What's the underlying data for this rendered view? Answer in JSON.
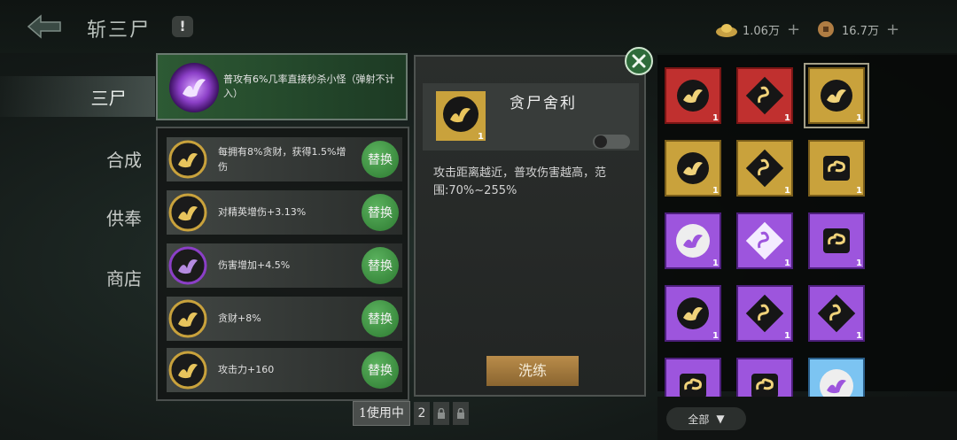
{
  "header": {
    "title": "斩三尸",
    "info": "!"
  },
  "currency": [
    {
      "icon": "gold-ingot-icon",
      "amount": "1.06万"
    },
    {
      "icon": "copper-coin-icon",
      "amount": "16.7万"
    }
  ],
  "tabs": [
    "三尸",
    "合成",
    "供奉",
    "商店"
  ],
  "effect_top": {
    "text": "普攻有6%几率直接秒杀小怪（弹射不计入）"
  },
  "effects": [
    {
      "text": "每拥有8%贪财，获得1.5%增伤",
      "button": "替换",
      "color": "gold"
    },
    {
      "text": "对精英增伤+3.13%",
      "button": "替换",
      "color": "gold"
    },
    {
      "text": "伤害增加+4.5%",
      "button": "替换",
      "color": "purple"
    },
    {
      "text": "贪财+8%",
      "button": "替换",
      "color": "gold"
    },
    {
      "text": "攻击力+160",
      "button": "替换",
      "color": "gold"
    }
  ],
  "pager": {
    "current": "1使用中",
    "next": "2"
  },
  "detail": {
    "name": "贪尸舍利",
    "count": "1",
    "description": "攻击距离越近，普攻伤害越高，范围:70%~255%",
    "refine_button": "洗练"
  },
  "inventory": [
    {
      "bg": "red",
      "icon": "bird",
      "count": "1"
    },
    {
      "bg": "red",
      "icon": "snake",
      "count": "1"
    },
    {
      "bg": "gold",
      "icon": "bird",
      "count": "1",
      "selected": true
    },
    {
      "bg": "gold",
      "icon": "bird",
      "count": "1"
    },
    {
      "bg": "gold",
      "icon": "snake",
      "count": "1"
    },
    {
      "bg": "gold",
      "icon": "cloud",
      "count": "1"
    },
    {
      "bg": "purple",
      "icon": "bird-orb",
      "count": "1"
    },
    {
      "bg": "purple",
      "icon": "snake-orb",
      "count": "1"
    },
    {
      "bg": "purple",
      "icon": "cloud",
      "count": "1"
    },
    {
      "bg": "purple",
      "icon": "bird",
      "count": "1"
    },
    {
      "bg": "purple",
      "icon": "snake",
      "count": "1"
    },
    {
      "bg": "purple",
      "icon": "snake",
      "count": "1"
    },
    {
      "bg": "purple",
      "icon": "cloud",
      "count": ""
    },
    {
      "bg": "purple",
      "icon": "cloud",
      "count": ""
    },
    {
      "bg": "blue",
      "icon": "bird-orb",
      "count": ""
    }
  ],
  "filter": {
    "label": "全部"
  },
  "colors": {
    "gold": "#c9a23c",
    "purple": "#8b3fc7",
    "red": "#b3262a",
    "blue": "#5fb0e8",
    "swap_green": "#3f9a43",
    "refine_gold": "#a97c3e"
  }
}
